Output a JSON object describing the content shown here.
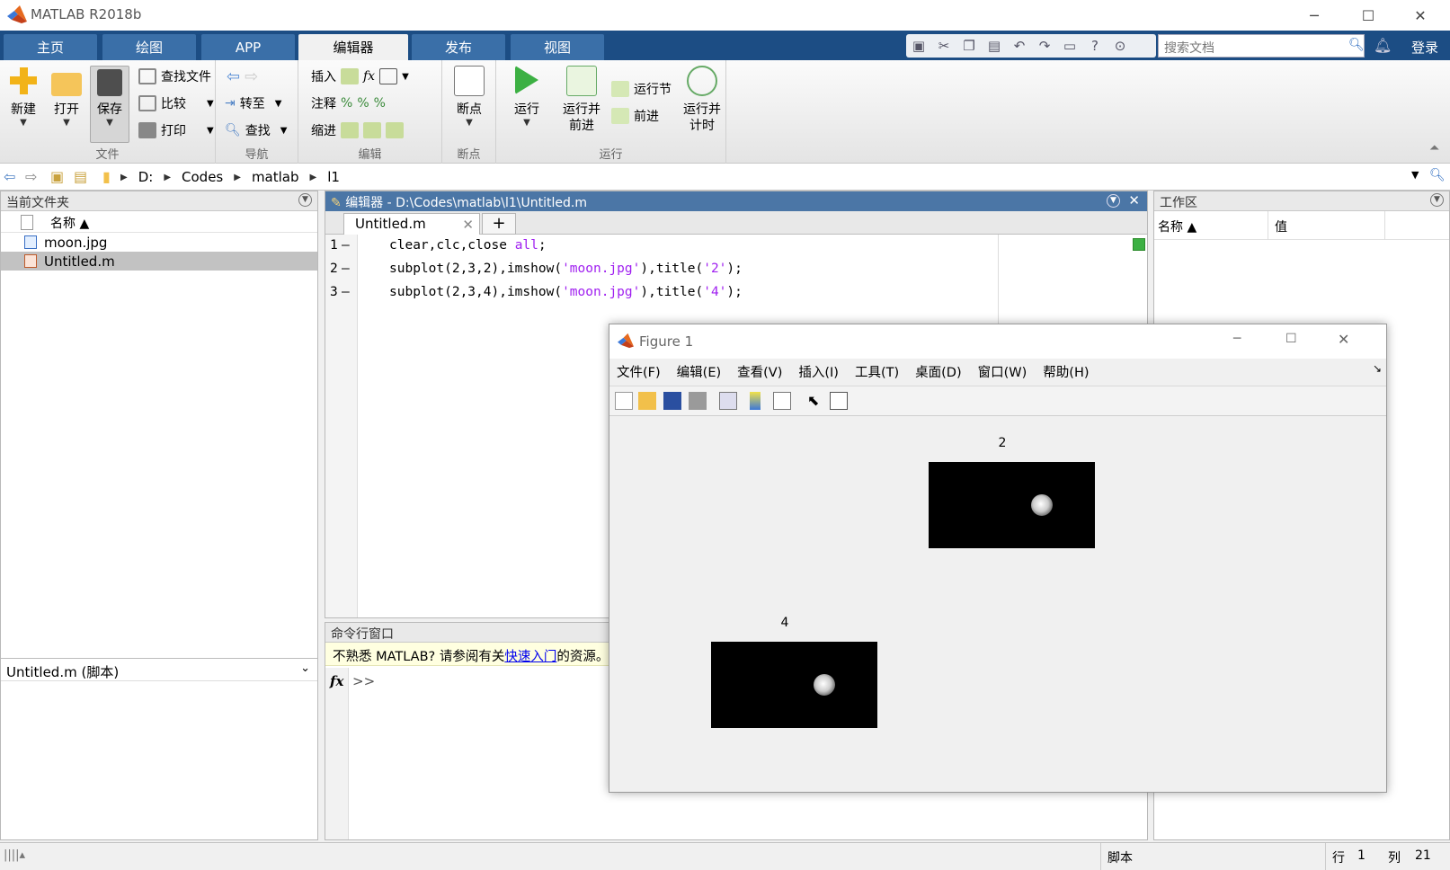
{
  "app": {
    "title": "MATLAB R2018b"
  },
  "ribbon_tabs": [
    "主页",
    "绘图",
    "APP",
    "编辑器",
    "发布",
    "视图"
  ],
  "active_tab": "编辑器",
  "search": {
    "placeholder": "搜索文档"
  },
  "login_label": "登录",
  "ribbon": {
    "file": {
      "label": "文件",
      "new": "新建",
      "open": "打开",
      "save": "保存",
      "find_files": "查找文件",
      "compare": "比较",
      "print": "打印"
    },
    "navigate": {
      "label": "导航",
      "goto": "转至",
      "find": "查找"
    },
    "edit": {
      "label": "编辑",
      "insert": "插入",
      "comment": "注释",
      "indent": "缩进",
      "fx": "fx"
    },
    "breakpoints": {
      "label": "断点",
      "breakpoints": "断点"
    },
    "run": {
      "label": "运行",
      "run": "运行",
      "run_advance_1": "运行并",
      "run_advance_2": "前进",
      "run_section": "运行节",
      "advance": "前进",
      "run_time_1": "运行并",
      "run_time_2": "计时"
    }
  },
  "path": [
    "D:",
    "Codes",
    "matlab",
    "l1"
  ],
  "current_folder": {
    "title": "当前文件夹",
    "col_name": "名称 ▲",
    "files": [
      {
        "name": "moon.jpg",
        "selected": false
      },
      {
        "name": "Untitled.m",
        "selected": true
      }
    ],
    "details_title": "Untitled.m  (脚本)"
  },
  "editor": {
    "title": "编辑器 - D:\\Codes\\matlab\\l1\\Untitled.m",
    "tab": "Untitled.m",
    "lines": [
      {
        "num": "1",
        "code_a": "clear,clc,close ",
        "code_kw": "all",
        "code_b": ";",
        "code_c": "",
        "code_d": "",
        "code_e": ""
      },
      {
        "num": "2",
        "code_a": "subplot(2,3,2),imshow(",
        "code_kw": "'moon.jpg'",
        "code_b": "),title(",
        "code_c": "'2'",
        "code_d": ");",
        "code_e": ""
      },
      {
        "num": "3",
        "code_a": "subplot(2,3,4),imshow(",
        "code_kw": "'moon.jpg'",
        "code_b": "),title(",
        "code_c": "'4'",
        "code_d": ");",
        "code_e": ""
      }
    ]
  },
  "command_window": {
    "title": "命令行窗口",
    "notice_a": "不熟悉 MATLAB? 请参阅有关",
    "notice_link": "快速入门",
    "notice_b": "的资源。",
    "prompt": ">>",
    "fx": "fx"
  },
  "workspace": {
    "title": "工作区",
    "col_name": "名称 ▲",
    "col_value": "值"
  },
  "figure": {
    "title": "Figure 1",
    "menus": [
      "文件(F)",
      "编辑(E)",
      "查看(V)",
      "插入(I)",
      "工具(T)",
      "桌面(D)",
      "窗口(W)",
      "帮助(H)"
    ],
    "subplot_titles": [
      "2",
      "4"
    ]
  },
  "status": {
    "type": "脚本",
    "row_label": "行",
    "row": "1",
    "col_label": "列",
    "col": "21"
  },
  "colors": {
    "tabbar": "#1c4d84",
    "active_tab": "#f1f1f1",
    "string": "#a020f0",
    "selection": "#c2c2c2"
  }
}
